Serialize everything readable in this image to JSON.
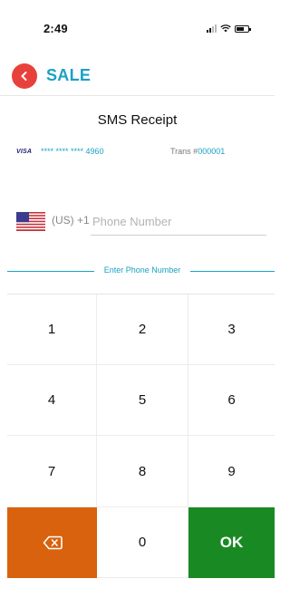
{
  "status_bar": {
    "time": "2:49",
    "signal_icon": "signal-icon",
    "wifi_icon": "wifi-icon",
    "battery_icon": "battery-icon"
  },
  "header": {
    "title": "SALE",
    "back_icon": "back-arrow-icon"
  },
  "receipt": {
    "title": "SMS Receipt",
    "card_brand": "VISA",
    "card_number": "**** **** **** 4960",
    "trans_label": "Trans #",
    "trans_number": "000001"
  },
  "phone": {
    "country_code": "(US) +1",
    "placeholder": "Phone Number",
    "value": ""
  },
  "prompt": "Enter Phone Number",
  "keypad": {
    "keys": [
      "1",
      "2",
      "3",
      "4",
      "5",
      "6",
      "7",
      "8",
      "9"
    ],
    "zero": "0",
    "ok": "OK",
    "delete_icon": "backspace-icon"
  },
  "colors": {
    "accent": "#1aa2c4",
    "back_button": "#e8413b",
    "delete_key": "#d9620e",
    "ok_key": "#198a23"
  }
}
